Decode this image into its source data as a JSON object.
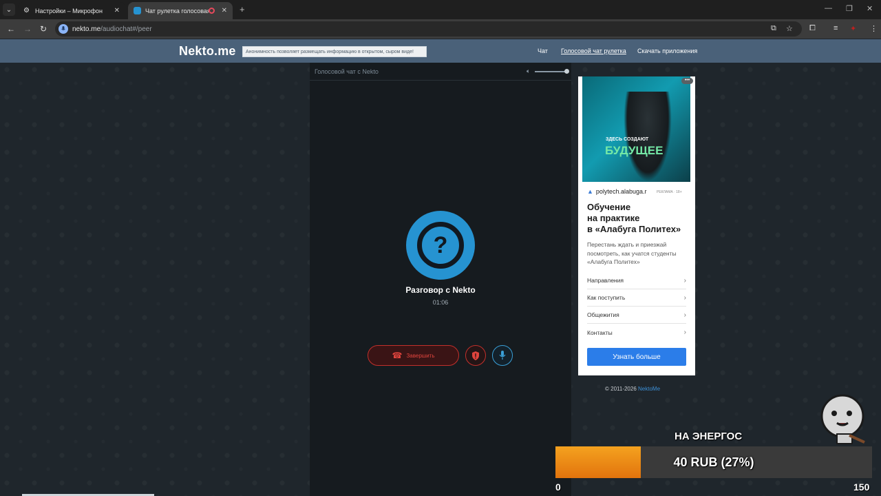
{
  "browser": {
    "tabs": [
      {
        "title": "Настройки – Микрофон",
        "active": false
      },
      {
        "title": "Чат рулетка голосовая — ",
        "active": true
      }
    ],
    "url_host": "nekto.me",
    "url_path": "/audiochat#/peer"
  },
  "site": {
    "logo": "Nekto.me",
    "notice": "Анонимность позволяет размещать информацию в открытом, сыром виде!",
    "nav": [
      "Чат",
      "Голосовой чат рулетка",
      "Скачать приложения"
    ]
  },
  "call": {
    "panel_title": "Голосовой чат с Nekto",
    "avatar_symbol": "?",
    "peer_name": "Разговор с Nekto",
    "timer": "01:06",
    "end_label": "Завершить",
    "accent": "#2693d1",
    "danger": "#e0443d"
  },
  "ad": {
    "image_small_text": "ЗДЕСЬ СОЗДАЮТ",
    "image_big_text": "БУДУЩЕЕ",
    "domain": "polytech.alabuga.r",
    "label": "РЕКЛАМА · 18+",
    "title_lines": [
      "Обучение",
      "на практике",
      "в «Алабуга Политех»"
    ],
    "description": "Перестань ждать и приезжай посмотреть, как учатся студенты «Алабуга Политех»",
    "links": [
      "Направления",
      "Как поступить",
      "Общежития",
      "Контакты"
    ],
    "cta": "Узнать больше"
  },
  "footer": {
    "copyright": "© 2011-2026",
    "link": "NektoMe"
  },
  "donation": {
    "title": "НА ЭНЕРГОС",
    "progress_text": "40 RUB (27%)",
    "progress_fraction": 0.27,
    "min": "0",
    "max": "150"
  }
}
